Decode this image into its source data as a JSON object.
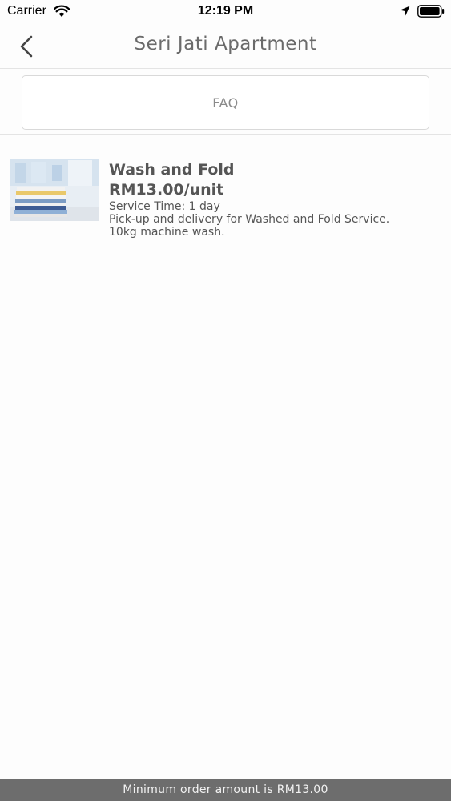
{
  "status_bar": {
    "carrier": "Carrier",
    "time": "12:19 PM",
    "wifi_icon": "wifi-icon",
    "location_icon": "location-arrow-icon",
    "battery_icon": "battery-icon"
  },
  "nav": {
    "title": "Seri Jati Apartment",
    "back_icon": "chevron-left-icon"
  },
  "faq": {
    "label": "FAQ"
  },
  "services": [
    {
      "name": "Wash and Fold",
      "price": "RM13.00/unit",
      "service_time": "Service Time: 1 day",
      "description": "Pick-up and delivery for Washed and Fold Service.",
      "description2": "10kg machine wash."
    }
  ],
  "footer": {
    "message": "Minimum order amount is RM13.00"
  },
  "colors": {
    "footer_bg": "#6d6d6d",
    "text": "#555555",
    "border": "#e4e4e4"
  }
}
